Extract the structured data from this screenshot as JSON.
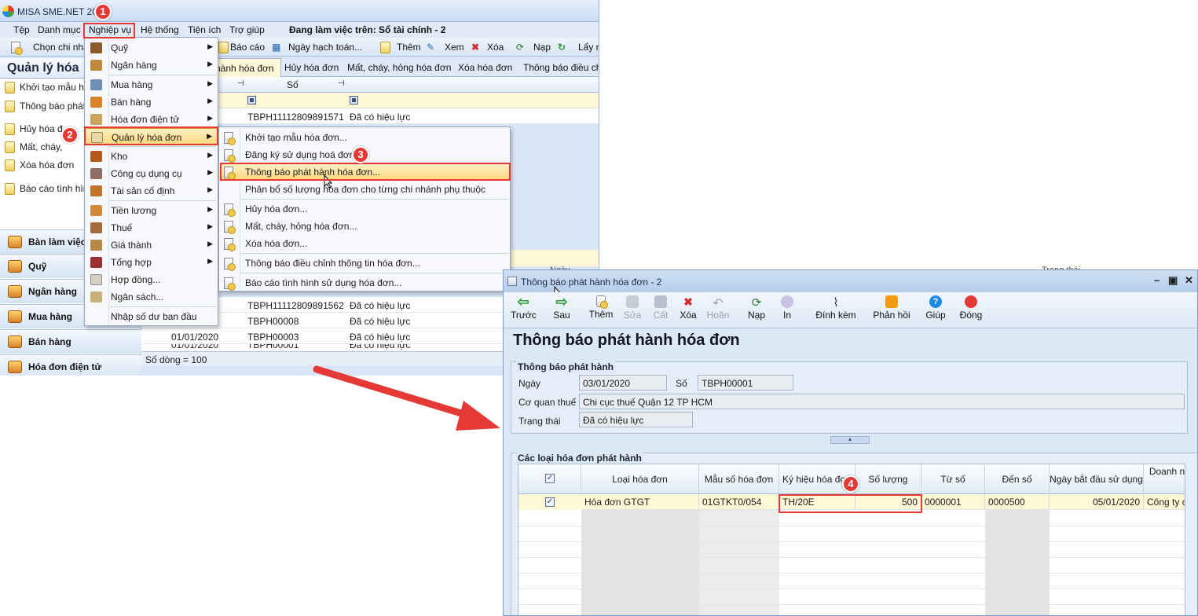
{
  "main": {
    "title": "MISA SME.NET 20",
    "menu": [
      "Tệp",
      "Danh mục",
      "Nghiệp vụ",
      "Hệ thống",
      "Tiện ích",
      "Trợ giúp"
    ],
    "working_on": "Đang làm việc trên: Sổ tài chính - 2",
    "toolbar": {
      "choose_branch": "Chọn chi nhá",
      "report": "Báo cáo",
      "posting_date": "Ngày hạch toán...",
      "add": "Thêm",
      "view": "Xem",
      "delete": "Xóa",
      "reload": "Nạp",
      "get": "Lấy m"
    },
    "left_panel": {
      "title": "Quản lý hóa",
      "items": [
        "Khởi tạo mẫu hó",
        "Thông báo phát",
        "Hủy hóa đ",
        "Mất, cháy,",
        "Xóa hóa đơn",
        "Báo cáo tình hìn"
      ],
      "nav": [
        "Bàn làm việc",
        "Quỹ",
        "Ngân hàng",
        "Mua hàng",
        "Bán hàng",
        "Hóa đơn điện tử"
      ]
    },
    "tabs": [
      "hành hóa đơn",
      "Hủy hóa đơn",
      "Mất, cháy, hỏng hóa đơn",
      "Xóa hóa đơn",
      "Thông báo điều chỉ"
    ],
    "grid": {
      "col_so": "Số",
      "rows": [
        {
          "date": "",
          "so": "TBPH11112809891571",
          "status": "Đã có hiệu lực"
        },
        {
          "date": "",
          "so": "TBPH11112809891562",
          "status": "Đã có hiệu lực"
        },
        {
          "date": "",
          "so": "TBPH00008",
          "status": "Đã có hiệu lực"
        },
        {
          "date": "01/01/2020",
          "so": "TBPH00003",
          "status": "Đã có hiệu lực"
        },
        {
          "date": "01/01/2020",
          "so": "TBPH00001",
          "status": "Đã có hiệu lực"
        }
      ],
      "footer": "Số dòng = 100",
      "partial_header_left": "Ngày",
      "partial_header_right": "Trạng thái"
    }
  },
  "menu1": [
    {
      "label": "Quỹ",
      "sub": true
    },
    {
      "label": "Ngân hàng",
      "sub": true
    },
    {
      "label": "Mua hàng",
      "sub": true
    },
    {
      "label": "Bán hàng",
      "sub": true
    },
    {
      "label": "Hóa đơn điện tử",
      "sub": true
    },
    {
      "label": "Quản lý hóa đơn",
      "sub": true
    },
    {
      "label": "Kho",
      "sub": true
    },
    {
      "label": "Công cụ dụng cụ",
      "sub": true
    },
    {
      "label": "Tài sản cố định",
      "sub": true
    },
    {
      "label": "Tiền lương",
      "sub": true
    },
    {
      "label": "Thuế",
      "sub": true
    },
    {
      "label": "Giá thành",
      "sub": true
    },
    {
      "label": "Tổng hợp",
      "sub": true
    },
    {
      "label": "Hợp đồng...",
      "sub": false
    },
    {
      "label": "Ngân sách...",
      "sub": false
    },
    {
      "label": "Nhập số dư ban đầu",
      "sub": false
    }
  ],
  "menu2": [
    "Khởi tạo mẫu hóa đơn...",
    "Đăng ký sử dụng hoá đơn",
    "Thông báo phát hành hóa đơn...",
    "Phân bổ số lượng hóa đơn cho từng chi nhánh phụ thuộc",
    "Hủy hóa đơn...",
    "Mất, cháy, hỏng hóa đơn...",
    "Xóa hóa đơn...",
    "Thông báo điều chỉnh thông tin hóa đơn...",
    "Báo cáo tình hình sử dụng hóa đơn..."
  ],
  "steps": [
    "1",
    "2",
    "3",
    "4"
  ],
  "dialog": {
    "title": "Thông báo phát hành hóa đơn - 2",
    "toolbar": [
      "Trước",
      "Sau",
      "Thêm",
      "Sửa",
      "Cất",
      "Xóa",
      "Hoãn",
      "Nạp",
      "In",
      "Đính kèm",
      "Phản hồi",
      "Giúp",
      "Đóng"
    ],
    "heading": "Thông báo phát hành hóa đơn",
    "group1": "Thông báo phát hành",
    "date_label": "Ngày",
    "date_value": "03/01/2020",
    "no_label": "Số",
    "no_value": "TBPH00001",
    "tax_label": "Cơ quan thuế",
    "tax_value": "Chi cục thuế Quận 12 TP HCM",
    "status_label": "Trạng thái",
    "status_value": "Đã có hiệu lực",
    "group2": "Các loại hóa đơn phát hành",
    "columns": [
      "Loại hóa đơn",
      "Mẫu số hóa đơn",
      "Ký hiệu hóa đơn",
      "Số lượng",
      "Từ số",
      "Đến số",
      "Ngày bắt đầu sử dụng",
      "Doanh n"
    ],
    "row": {
      "type": "Hóa đơn GTGT",
      "form": "01GTKT0/054",
      "symbol": "TH/20E",
      "qty": "500",
      "from": "0000001",
      "to": "0000500",
      "start": "05/01/2020",
      "company": "Công ty c"
    }
  }
}
